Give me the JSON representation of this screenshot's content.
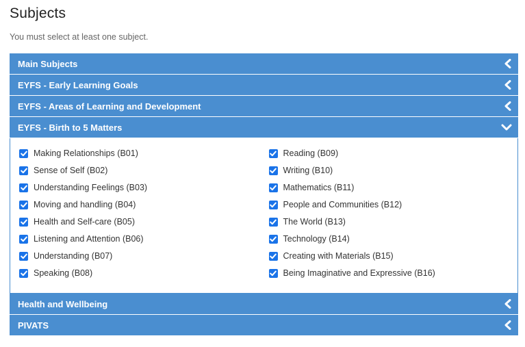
{
  "page": {
    "title": "Subjects",
    "hint": "You must select at least one subject."
  },
  "panels": {
    "main_subjects": {
      "label": "Main Subjects",
      "state": "collapsed"
    },
    "eyfs_elg": {
      "label": "EYFS - Early Learning Goals",
      "state": "collapsed"
    },
    "eyfs_areas": {
      "label": "EYFS - Areas of Learning and Development",
      "state": "collapsed"
    },
    "eyfs_birth": {
      "label": "EYFS - Birth to 5 Matters",
      "state": "expanded",
      "left_items": [
        {
          "label": "Making Relationships (B01)",
          "checked": true
        },
        {
          "label": "Sense of Self (B02)",
          "checked": true
        },
        {
          "label": "Understanding Feelings (B03)",
          "checked": true
        },
        {
          "label": "Moving and handling (B04)",
          "checked": true
        },
        {
          "label": "Health and Self-care (B05)",
          "checked": true
        },
        {
          "label": "Listening and Attention (B06)",
          "checked": true
        },
        {
          "label": "Understanding (B07)",
          "checked": true
        },
        {
          "label": "Speaking (B08)",
          "checked": true
        }
      ],
      "right_items": [
        {
          "label": "Reading (B09)",
          "checked": true
        },
        {
          "label": "Writing (B10)",
          "checked": true
        },
        {
          "label": "Mathematics (B11)",
          "checked": true
        },
        {
          "label": "People and Communities (B12)",
          "checked": true
        },
        {
          "label": "The World (B13)",
          "checked": true
        },
        {
          "label": "Technology (B14)",
          "checked": true
        },
        {
          "label": "Creating with Materials (B15)",
          "checked": true
        },
        {
          "label": "Being Imaginative and Expressive (B16)",
          "checked": true
        }
      ]
    },
    "health": {
      "label": "Health and Wellbeing",
      "state": "collapsed"
    },
    "pivats": {
      "label": "PIVATS",
      "state": "collapsed"
    }
  },
  "colors": {
    "header_bg": "#4a8ed0",
    "checkbox": "#1a73e8"
  },
  "icons": {
    "collapsed": "chevron-left-icon",
    "expanded": "chevron-down-icon",
    "checked": "checkmark-icon"
  }
}
